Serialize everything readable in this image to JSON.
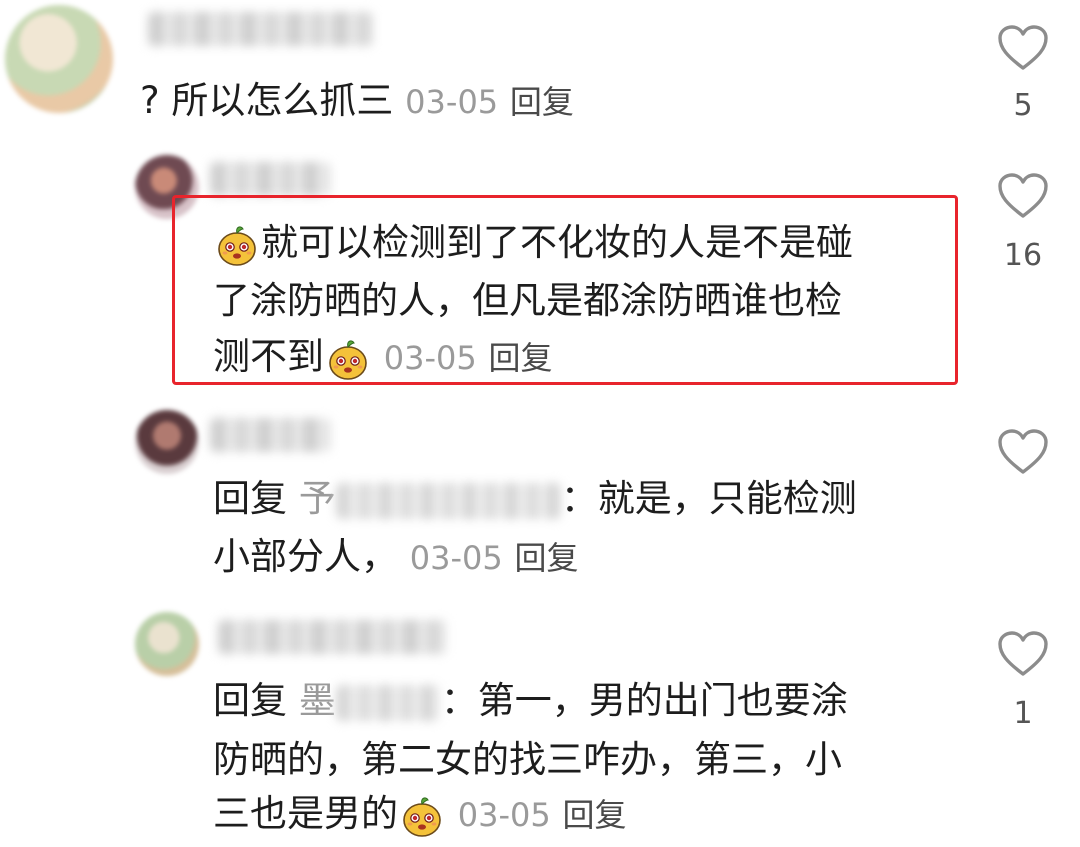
{
  "comments": [
    {
      "id": "c1",
      "prefix": "?",
      "text": "所以怎么抓三",
      "date": "03-05",
      "reply_label": "回复",
      "likes": "5"
    },
    {
      "id": "c2",
      "line1": "就可以检测到了不化妆的人是不是碰",
      "line2": "了涂防晒的人，但凡是都涂防晒谁也检",
      "line3": "测不到",
      "date": "03-05",
      "reply_label": "回复",
      "likes": "16"
    },
    {
      "id": "c3",
      "reply_prefix": "回复",
      "mention_start": "予",
      "after_mention": "：就是，只能检测",
      "line2": "小部分人，",
      "date": "03-05",
      "reply_label": "回复"
    },
    {
      "id": "c4",
      "reply_prefix": "回复",
      "mention_start": "墨",
      "after_mention": "：第一，男的出门也要涂",
      "line2": "防晒的，第二女的找三咋办，第三，小",
      "line3": "三也是男的",
      "date": "03-05",
      "reply_label": "回复",
      "likes": "1"
    }
  ],
  "colors": {
    "highlight": "#e8242c",
    "meta": "#9a9a9a",
    "text": "#1d1d1d"
  },
  "icons": {
    "like": "heart-outline-icon",
    "emoji": "smiling-mango-sticker"
  }
}
